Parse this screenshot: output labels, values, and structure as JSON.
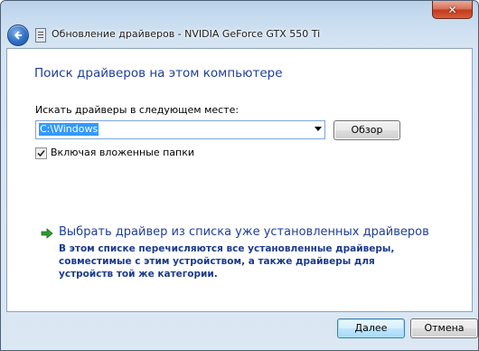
{
  "window": {
    "title": "Обновление драйверов - NVIDIA GeForce GTX 550 Ti",
    "close_label": "✕"
  },
  "content": {
    "heading": "Поиск драйверов на этом компьютере",
    "path_label": "Искать драйверы в следующем месте:",
    "path_value": "C:\\Windows",
    "browse_label": "Обзор",
    "checkbox_label": "Включая вложенные папки",
    "checkbox_checked": true,
    "link_title": "Выбрать драйвер из списка уже установленных драйверов",
    "link_description": "В этом списке перечисляются все установленные драйверы, совместимые с этим устройством, а также драйверы для устройств той же категории."
  },
  "footer": {
    "next_label": "Далее",
    "cancel_label": "Отмена"
  },
  "colors": {
    "heading": "#1e3e99",
    "selection": "#3399ff",
    "arrow": "#2e9a2e"
  },
  "icons": {
    "back": "back-arrow-icon",
    "device": "device-icon",
    "link_arrow": "green-arrow-icon",
    "checkmark": "checkmark-icon"
  }
}
